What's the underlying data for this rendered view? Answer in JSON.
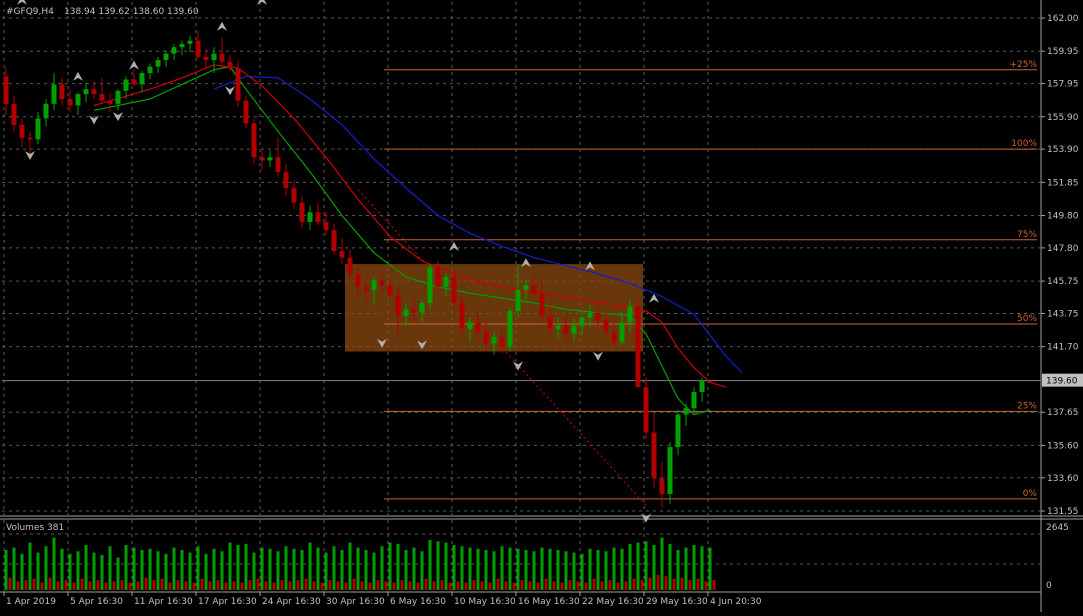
{
  "chart_data": {
    "type": "candlestick",
    "symbol_header": "#GFQ9,H4",
    "ohlc_header": "138.94 139.62 138.60 139.60",
    "current_price_label": "139.60",
    "current_price": 139.6,
    "y_axis": {
      "range": [
        131.55,
        162.0
      ],
      "tick_labels": [
        "162.00",
        "159.95",
        "157.95",
        "155.90",
        "153.90",
        "151.85",
        "149.80",
        "147.80",
        "145.75",
        "143.75",
        "141.70",
        "139.60",
        "137.65",
        "135.60",
        "133.60",
        "131.55"
      ],
      "tick_values": [
        162.0,
        159.95,
        157.95,
        155.9,
        153.9,
        151.85,
        149.8,
        147.8,
        145.75,
        143.75,
        141.7,
        139.6,
        137.65,
        135.6,
        133.6,
        131.55
      ]
    },
    "x_axis": {
      "tick_labels": [
        "1 Apr 2019",
        "5 Apr 16:30",
        "11 Apr 16:30",
        "17 Apr 16:30",
        "24 Apr 16:30",
        "30 Apr 16:30",
        "6 May 16:30",
        "10 May 16:30",
        "16 May 16:30",
        "22 May 16:30",
        "29 May 16:30",
        "4 Jun 20:30"
      ],
      "tick_bar_index": [
        0,
        8,
        16,
        24,
        32,
        40,
        48,
        56,
        64,
        72,
        80,
        88
      ]
    },
    "grid": true,
    "colors": {
      "background": "#000000",
      "grid": "#5a5a5a",
      "text": "#c0c0c0",
      "bull": "#00a000",
      "bear": "#b00000",
      "ma_fast": "#00a000",
      "ma_mid": "#d00000",
      "ma_slow": "#1020d0",
      "fibo": "#c86432",
      "box": "#8b4a10",
      "price_line": "#808080",
      "fractal": "#b0b0b0"
    },
    "candles": [
      [
        158.4,
        159.0,
        156.0,
        156.7
      ],
      [
        156.7,
        157.2,
        155.0,
        155.4
      ],
      [
        155.4,
        155.8,
        154.0,
        154.6
      ],
      [
        154.6,
        155.0,
        153.6,
        154.5
      ],
      [
        154.5,
        156.2,
        154.2,
        155.8
      ],
      [
        155.8,
        157.0,
        155.3,
        156.7
      ],
      [
        156.7,
        158.6,
        156.3,
        157.9
      ],
      [
        157.9,
        158.3,
        156.6,
        157.0
      ],
      [
        157.0,
        157.6,
        156.2,
        156.6
      ],
      [
        156.6,
        157.4,
        156.0,
        157.3
      ],
      [
        157.3,
        158.0,
        156.8,
        157.6
      ],
      [
        157.6,
        158.1,
        157.0,
        157.3
      ],
      [
        157.3,
        158.3,
        156.8,
        156.9
      ],
      [
        156.9,
        157.4,
        156.2,
        156.7
      ],
      [
        156.7,
        157.6,
        156.3,
        157.5
      ],
      [
        157.5,
        158.4,
        157.0,
        158.2
      ],
      [
        158.2,
        158.9,
        157.8,
        157.9
      ],
      [
        157.9,
        158.7,
        157.4,
        158.6
      ],
      [
        158.6,
        159.2,
        158.2,
        159.0
      ],
      [
        159.0,
        159.6,
        158.6,
        159.4
      ],
      [
        159.4,
        160.0,
        159.0,
        159.8
      ],
      [
        159.8,
        160.4,
        159.4,
        160.2
      ],
      [
        160.2,
        160.6,
        159.7,
        160.4
      ],
      [
        160.4,
        160.9,
        159.9,
        160.6
      ],
      [
        160.6,
        161.2,
        159.5,
        159.6
      ],
      [
        159.6,
        160.1,
        158.9,
        159.4
      ],
      [
        159.4,
        160.2,
        158.6,
        159.8
      ],
      [
        159.8,
        160.8,
        159.0,
        159.3
      ],
      [
        159.3,
        159.7,
        158.7,
        158.9
      ],
      [
        158.9,
        159.4,
        156.5,
        156.9
      ],
      [
        156.9,
        157.2,
        155.2,
        155.5
      ],
      [
        155.5,
        155.8,
        153.0,
        153.4
      ],
      [
        153.4,
        154.0,
        152.6,
        153.2
      ],
      [
        153.2,
        153.8,
        152.8,
        153.4
      ],
      [
        153.4,
        154.6,
        152.2,
        152.5
      ],
      [
        152.5,
        153.0,
        151.0,
        151.5
      ],
      [
        151.5,
        152.0,
        150.2,
        150.6
      ],
      [
        150.6,
        151.0,
        149.0,
        149.4
      ],
      [
        149.4,
        150.4,
        148.9,
        150.0
      ],
      [
        150.0,
        150.6,
        149.2,
        149.4
      ],
      [
        149.4,
        150.0,
        148.6,
        148.9
      ],
      [
        148.9,
        149.3,
        147.4,
        147.6
      ],
      [
        147.6,
        148.4,
        146.8,
        147.2
      ],
      [
        147.2,
        147.7,
        145.8,
        146.2
      ],
      [
        146.2,
        146.6,
        144.8,
        145.4
      ],
      [
        145.4,
        145.9,
        144.4,
        145.2
      ],
      [
        145.2,
        146.0,
        144.3,
        145.8
      ],
      [
        145.8,
        146.2,
        145.0,
        145.5
      ],
      [
        145.5,
        145.9,
        144.6,
        144.9
      ],
      [
        144.9,
        145.4,
        142.3,
        143.6
      ],
      [
        143.6,
        144.4,
        143.0,
        144.0
      ],
      [
        144.0,
        144.8,
        143.3,
        143.8
      ],
      [
        143.8,
        144.6,
        143.2,
        144.4
      ],
      [
        144.4,
        146.8,
        144.0,
        146.6
      ],
      [
        146.6,
        147.0,
        145.0,
        145.4
      ],
      [
        145.4,
        146.2,
        144.8,
        146.0
      ],
      [
        146.0,
        146.5,
        144.0,
        144.4
      ],
      [
        144.4,
        145.0,
        142.4,
        142.8
      ],
      [
        142.8,
        143.5,
        142.0,
        143.2
      ],
      [
        143.2,
        143.8,
        142.2,
        142.6
      ],
      [
        142.6,
        143.2,
        141.4,
        141.9
      ],
      [
        141.9,
        142.6,
        141.2,
        142.3
      ],
      [
        142.3,
        142.9,
        141.3,
        141.7
      ],
      [
        141.7,
        144.1,
        141.4,
        143.9
      ],
      [
        143.9,
        146.8,
        143.5,
        145.2
      ],
      [
        145.2,
        145.9,
        144.6,
        145.5
      ],
      [
        145.5,
        146.2,
        144.8,
        145.0
      ],
      [
        145.0,
        146.0,
        143.2,
        143.6
      ],
      [
        143.6,
        144.4,
        142.4,
        142.8
      ],
      [
        142.8,
        143.5,
        142.2,
        143.0
      ],
      [
        143.0,
        143.6,
        142.0,
        142.5
      ],
      [
        142.5,
        143.4,
        142.0,
        143.0
      ],
      [
        143.0,
        143.8,
        142.4,
        143.5
      ],
      [
        143.5,
        144.3,
        142.9,
        143.8
      ],
      [
        143.8,
        144.4,
        143.0,
        143.3
      ],
      [
        143.3,
        144.0,
        142.4,
        142.6
      ],
      [
        142.6,
        143.2,
        141.6,
        142.0
      ],
      [
        142.0,
        143.8,
        141.8,
        143.2
      ],
      [
        143.2,
        144.6,
        142.6,
        144.2
      ],
      [
        144.2,
        144.6,
        142.4,
        139.2
      ],
      [
        139.2,
        139.8,
        136.0,
        136.4
      ],
      [
        136.4,
        137.6,
        133.0,
        133.6
      ],
      [
        133.6,
        134.6,
        131.8,
        132.6
      ],
      [
        132.6,
        135.8,
        132.0,
        135.5
      ],
      [
        135.5,
        137.8,
        135.0,
        137.5
      ],
      [
        137.5,
        138.2,
        136.8,
        137.9
      ],
      [
        137.9,
        139.2,
        137.5,
        138.9
      ],
      [
        138.9,
        139.8,
        138.3,
        139.6
      ]
    ],
    "moving_averages": [
      {
        "color": "#00a000",
        "values": [
          [
            11,
            156.3
          ],
          [
            18,
            157.0
          ],
          [
            22,
            157.9
          ],
          [
            26,
            158.8
          ],
          [
            28,
            159.0
          ],
          [
            30,
            157.6
          ],
          [
            34,
            155.0
          ],
          [
            38,
            152.5
          ],
          [
            42,
            149.8
          ],
          [
            46,
            147.5
          ],
          [
            50,
            146.0
          ],
          [
            54,
            145.4
          ],
          [
            58,
            145.0
          ],
          [
            62,
            144.7
          ],
          [
            66,
            144.4
          ],
          [
            70,
            144.0
          ],
          [
            74,
            143.8
          ],
          [
            78,
            143.6
          ],
          [
            80,
            142.5
          ],
          [
            82,
            140.5
          ],
          [
            84,
            138.5
          ],
          [
            86,
            137.5
          ],
          [
            88,
            137.8
          ]
        ]
      },
      {
        "color": "#d00000",
        "values": [
          [
            11,
            156.6
          ],
          [
            18,
            157.6
          ],
          [
            22,
            158.3
          ],
          [
            26,
            159.1
          ],
          [
            29,
            158.9
          ],
          [
            32,
            157.8
          ],
          [
            36,
            155.8
          ],
          [
            40,
            153.4
          ],
          [
            44,
            150.8
          ],
          [
            48,
            148.5
          ],
          [
            52,
            147.0
          ],
          [
            56,
            146.2
          ],
          [
            60,
            145.6
          ],
          [
            64,
            145.2
          ],
          [
            68,
            144.9
          ],
          [
            72,
            144.6
          ],
          [
            76,
            144.3
          ],
          [
            80,
            143.9
          ],
          [
            82,
            143.2
          ],
          [
            84,
            141.6
          ],
          [
            86,
            140.4
          ],
          [
            88,
            139.5
          ],
          [
            90,
            139.2
          ]
        ]
      },
      {
        "color": "#1020d0",
        "values": [
          [
            26,
            157.6
          ],
          [
            30,
            158.4
          ],
          [
            34,
            158.3
          ],
          [
            38,
            157.0
          ],
          [
            42,
            155.4
          ],
          [
            46,
            153.3
          ],
          [
            50,
            151.5
          ],
          [
            54,
            149.8
          ],
          [
            58,
            148.7
          ],
          [
            62,
            147.9
          ],
          [
            66,
            147.2
          ],
          [
            70,
            146.7
          ],
          [
            74,
            146.2
          ],
          [
            78,
            145.6
          ],
          [
            82,
            144.8
          ],
          [
            86,
            143.7
          ],
          [
            88,
            142.4
          ],
          [
            90,
            141.1
          ],
          [
            92,
            140.1
          ]
        ]
      }
    ],
    "trend_line": {
      "color": "#d00000",
      "from": [
        44,
        151.4
      ],
      "to": [
        80,
        131.9
      ]
    },
    "fractals_up": [
      [
        2,
        163.0
      ],
      [
        9,
        158.3
      ],
      [
        16,
        159.0
      ],
      [
        27,
        161.4
      ],
      [
        32,
        163.0
      ],
      [
        56,
        147.8
      ],
      [
        65,
        146.8
      ],
      [
        73,
        146.6
      ],
      [
        81,
        144.6
      ]
    ],
    "fractals_down": [
      [
        3,
        153.6
      ],
      [
        11,
        155.8
      ],
      [
        14,
        156.0
      ],
      [
        28,
        157.6
      ],
      [
        47,
        142.0
      ],
      [
        52,
        141.9
      ],
      [
        64,
        140.6
      ],
      [
        74,
        141.2
      ],
      [
        80,
        131.2
      ]
    ],
    "fibo_levels": [
      {
        "label": "+25%",
        "value": 158.8
      },
      {
        "label": "100%",
        "value": 153.9
      },
      {
        "label": "75%",
        "value": 148.3
      },
      {
        "label": "50%",
        "value": 143.1
      },
      {
        "label": "25%",
        "value": 137.7
      },
      {
        "label": "0%",
        "value": 132.3
      }
    ],
    "fibo_x_start_bar": 45,
    "box": {
      "from_bar": 43,
      "to_bar": 79,
      "high": 146.8,
      "low": 141.4
    },
    "volume_panel": {
      "title": "Volumes 381",
      "ymax_label": "2645",
      "ymin_label": "0",
      "ymax": 2645,
      "bar_volumes": [
        1600,
        1700,
        1450,
        1900,
        1500,
        1750,
        2100,
        1650,
        1450,
        1550,
        1800,
        1500,
        1400,
        1750,
        1300,
        1800,
        1700,
        1600,
        1650,
        1550,
        1450,
        1700,
        1600,
        1500,
        1750,
        1450,
        1650,
        1550,
        1900,
        1800,
        1850,
        1500,
        1700,
        1650,
        1550,
        1750,
        1650,
        1600,
        1900,
        1700,
        1500,
        1750,
        1600,
        1900,
        1700,
        1600,
        1500,
        1750,
        1900,
        1850,
        1600,
        1700,
        1550,
        2000,
        1950,
        1900,
        1800,
        1750,
        1700,
        1650,
        1600,
        1550,
        1750,
        1700,
        1650,
        1600,
        1550,
        1700,
        1650,
        1600,
        1550,
        1500,
        1450,
        1650,
        1600,
        1550,
        1700,
        1650,
        1850,
        1900,
        1950,
        1800,
        2100,
        1850,
        1600,
        1700,
        1800,
        1750,
        1700
      ],
      "spike_volumes": [
        500,
        350,
        400,
        450,
        300,
        500,
        350,
        400,
        300,
        450,
        350,
        400,
        300,
        350,
        400,
        300,
        350,
        500,
        400,
        450,
        300,
        400,
        350,
        300,
        450,
        350,
        400,
        300,
        350,
        300,
        400,
        450,
        350,
        300,
        400,
        350,
        400,
        450,
        350,
        300,
        400,
        350,
        300,
        450,
        350,
        300,
        400,
        350,
        300,
        400,
        350,
        300,
        450,
        350,
        400,
        300,
        350,
        300,
        400,
        350,
        300,
        450,
        350,
        300,
        400,
        350,
        300,
        450,
        350,
        300,
        400,
        350,
        300,
        450,
        350,
        400,
        300,
        350,
        450,
        400,
        500,
        600,
        550,
        450,
        500,
        400,
        450,
        350,
        400
      ]
    }
  }
}
